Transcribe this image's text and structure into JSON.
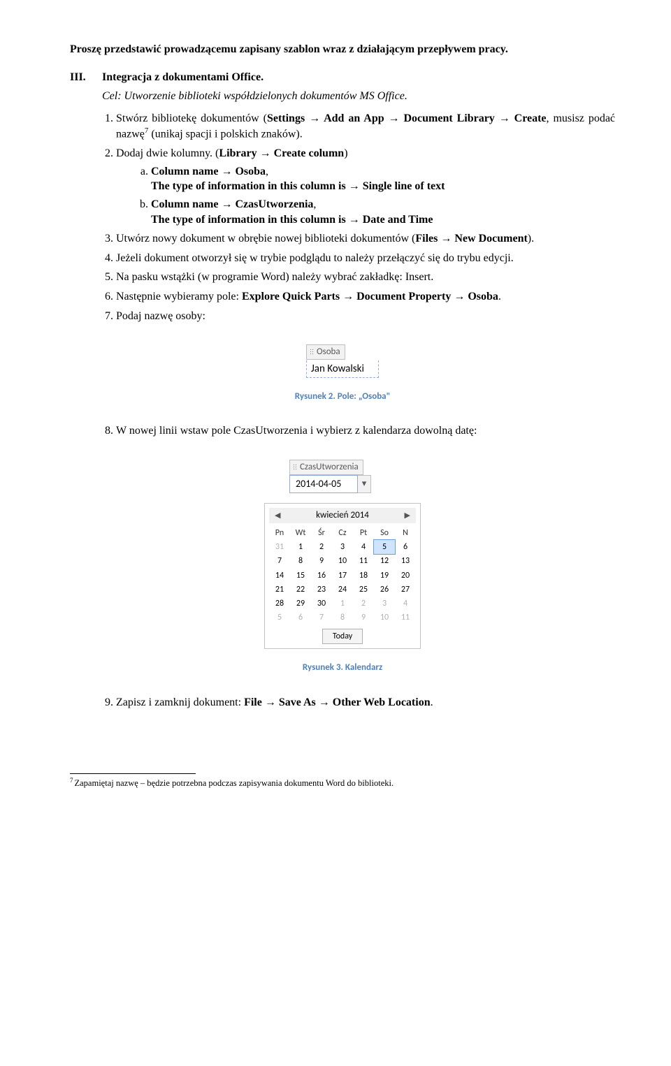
{
  "intro": "Proszę przedstawić prowadzącemu zapisany szablon wraz z działającym przepływem pracy.",
  "section": {
    "roman": "III.",
    "title": "Integracja z dokumentami Office.",
    "cel": "Cel: Utworzenie biblioteki współdzielonych dokumentów MS Office."
  },
  "steps": {
    "s1a": "Stwórz bibliotekę dokumentów (",
    "s1b": "Settings → Add an App → Document Library → Create",
    "s1c": ", musisz podać nazwę",
    "s1sup": "7",
    "s1d": " (unikaj spacji i polskich znaków).",
    "s2a": "Dodaj dwie kolumny. (",
    "s2b": "Library → Create column",
    "s2c": ")",
    "s2sa_a": "Column name → Osoba",
    "s2sa_b": ",",
    "s2sa_c": "The type of information in this column is → Single line of text",
    "s2sb_a": "Column name → CzasUtworzenia",
    "s2sb_b": ",",
    "s2sb_c": "The type of information in this column is → Date and Time",
    "s3a": "Utwórz nowy dokument w obrębie nowej biblioteki dokumentów (",
    "s3b": "Files → New Document",
    "s3c": ").",
    "s4": "Jeżeli dokument otworzył się w trybie podglądu to należy przełączyć się do trybu edycji.",
    "s5": "Na pasku wstążki (w programie Word) należy wybrać zakładkę: Insert.",
    "s6a": "Następnie wybieramy pole: ",
    "s6b": "Explore Quick Parts → Document Property → Osoba",
    "s6c": ".",
    "s7": "Podaj nazwę osoby:",
    "s8": "W nowej linii wstaw pole CzasUtworzenia i wybierz z kalendarza dowolną datę:",
    "s9a": "Zapisz i zamknij dokument: ",
    "s9b": "File → Save As → Other Web Location",
    "s9c": "."
  },
  "fig1": {
    "tag": "Osoba",
    "value": "Jan Kowalski",
    "caption": "Rysunek 2. Pole: „Osoba\""
  },
  "fig2": {
    "tag": "CzasUtworzenia",
    "value": "2014-04-05",
    "cal_title": "kwiecień 2014",
    "dow": [
      "Pn",
      "Wt",
      "Śr",
      "Cz",
      "Pt",
      "So",
      "N"
    ],
    "today": "Today",
    "caption": "Rysunek 3. Kalendarz",
    "cells": [
      [
        "31",
        "1",
        "2",
        "3",
        "4",
        "5",
        "6"
      ],
      [
        "7",
        "8",
        "9",
        "10",
        "11",
        "12",
        "13"
      ],
      [
        "14",
        "15",
        "16",
        "17",
        "18",
        "19",
        "20"
      ],
      [
        "21",
        "22",
        "23",
        "24",
        "25",
        "26",
        "27"
      ],
      [
        "28",
        "29",
        "30",
        "1",
        "2",
        "3",
        "4"
      ],
      [
        "5",
        "6",
        "7",
        "8",
        "9",
        "10",
        "11"
      ]
    ]
  },
  "footnote": {
    "num": "7",
    "text": "Zapamiętaj nazwę – będzie potrzebna podczas zapisywania dokumentu Word do biblioteki."
  }
}
